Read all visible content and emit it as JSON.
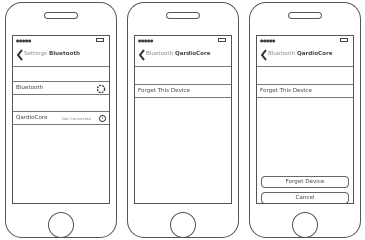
{
  "phones": [
    {
      "status": {
        "signal": "●●●●●",
        "battery_icon": "battery-icon"
      },
      "nav": {
        "back_label": "Settings",
        "title": "Bluetooth"
      },
      "rows": [
        {
          "label": "Bluetooth",
          "control": "loading-spinner-icon"
        },
        {
          "label": "QardioCore",
          "status": "Not Connected",
          "control": "info-icon"
        }
      ]
    },
    {
      "status": {
        "signal": "●●●●●",
        "battery_icon": "battery-icon"
      },
      "nav": {
        "back_label": "Bluetooth",
        "title": "QardioCore"
      },
      "rows": [
        {
          "label": "Forget This Device"
        }
      ]
    },
    {
      "status": {
        "signal": "●●●●●",
        "battery_icon": "battery-icon"
      },
      "nav": {
        "back_label": "Bluetooth",
        "title": "QardioCore"
      },
      "rows": [
        {
          "label": "Forget This Device"
        }
      ],
      "action_sheet": {
        "confirm_label": "Forget Device",
        "cancel_label": "Cancel"
      }
    }
  ],
  "info_glyph": "i"
}
